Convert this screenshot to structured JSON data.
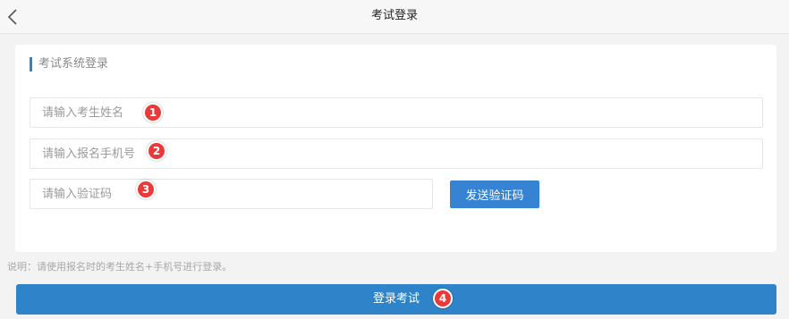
{
  "header": {
    "title": "考试登录"
  },
  "form": {
    "section_title": "考试系统登录",
    "name_placeholder": "请输入考生姓名",
    "phone_placeholder": "请输入报名手机号",
    "code_placeholder": "请输入验证码",
    "send_code_label": "发送验证码"
  },
  "badges": [
    "1",
    "2",
    "3",
    "4"
  ],
  "note": "说明：请使用报名时的考生姓名+手机号进行登录。",
  "login_button_label": "登录考试",
  "colors": {
    "accent": "#2f84c9",
    "badge": "#e83a3a",
    "background": "#f3f3f3"
  }
}
